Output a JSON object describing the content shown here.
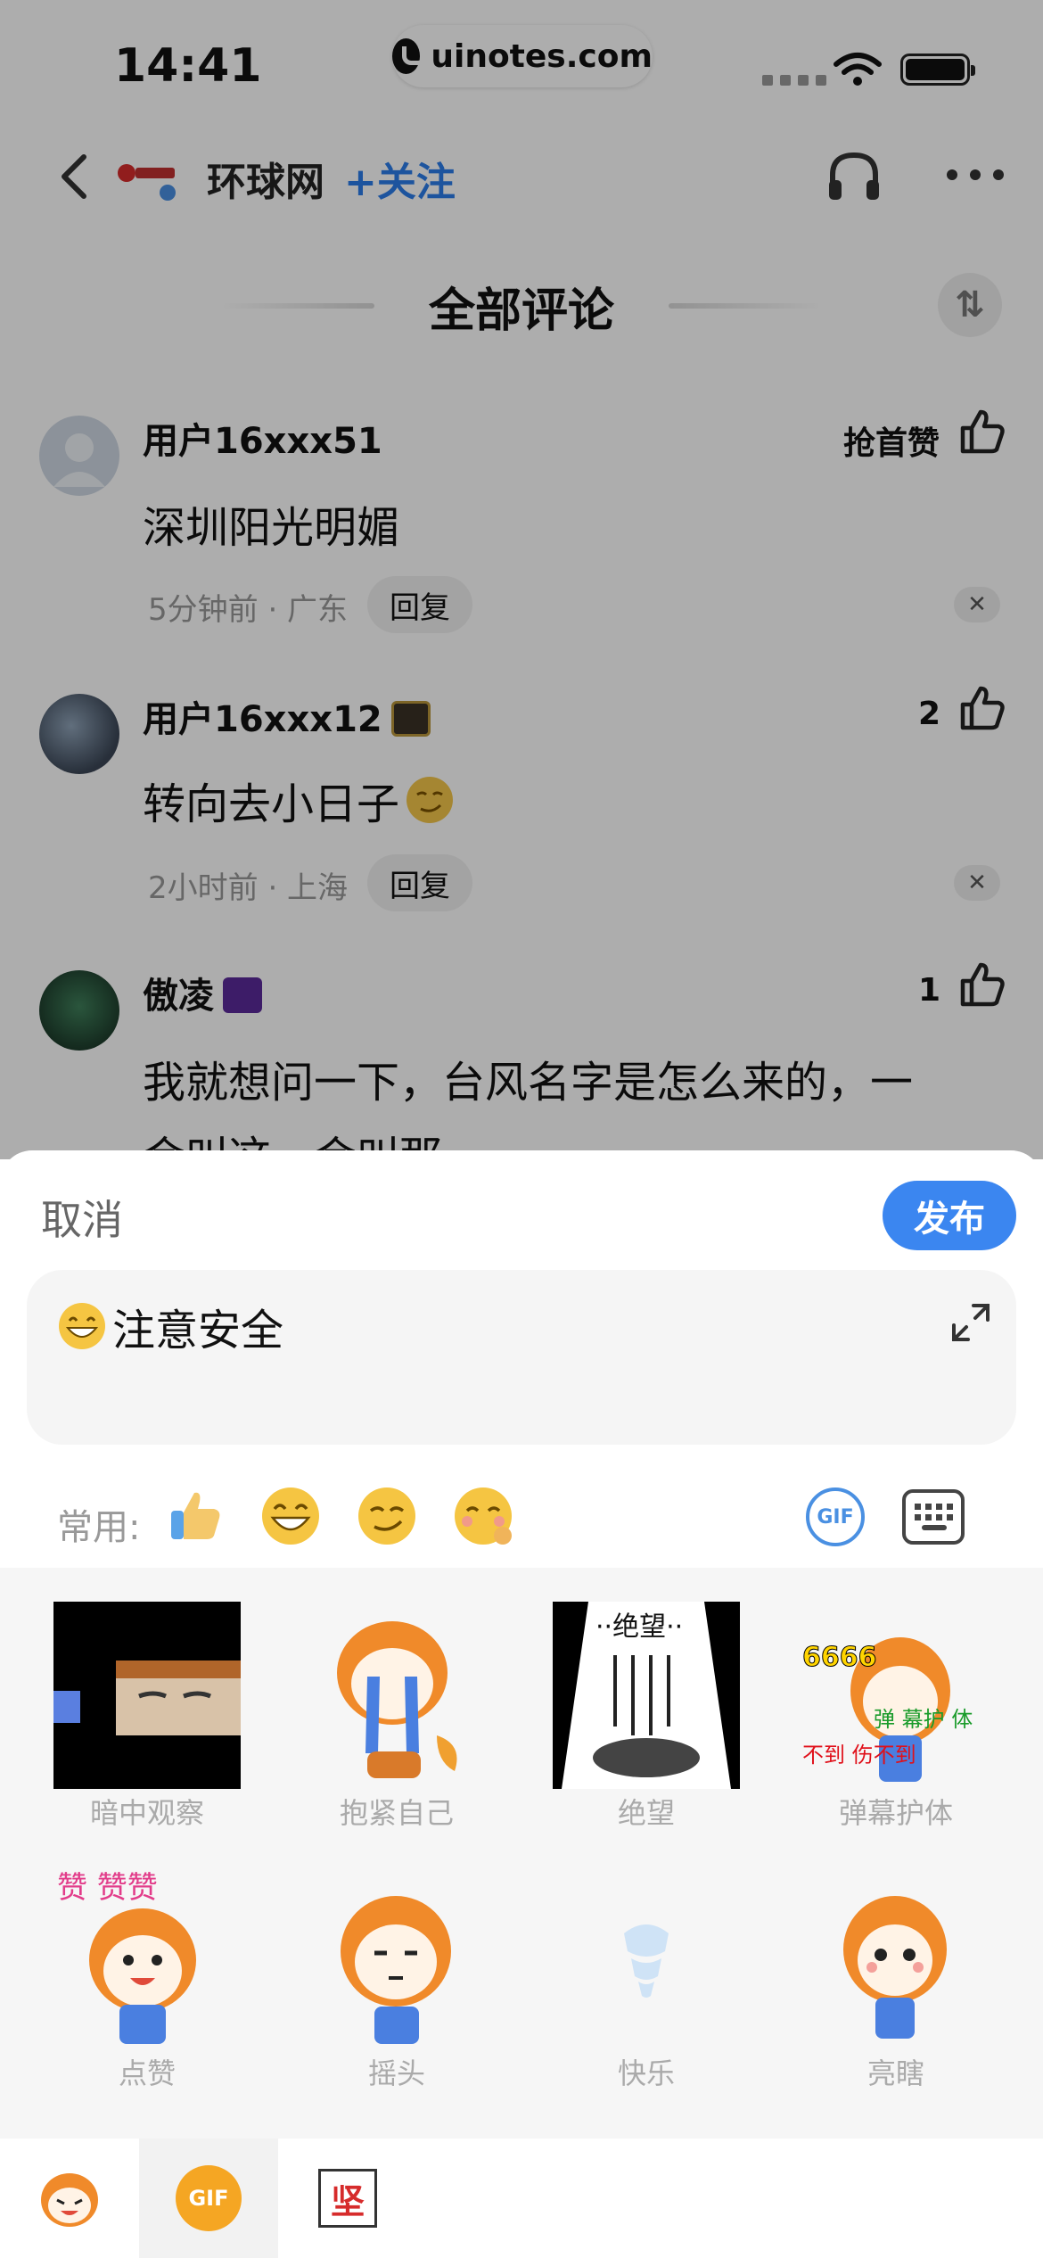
{
  "status_bar": {
    "time": "14:41",
    "url": "uinotes.com"
  },
  "header": {
    "publisher": "环球网",
    "follow": "+关注"
  },
  "section": {
    "title": "全部评论"
  },
  "comments": [
    {
      "user": "用户16xxx51",
      "text": "深圳阳光明媚",
      "meta": "5分钟前 · 广东",
      "reply": "回复",
      "likes": "抢首赞"
    },
    {
      "user": "用户16xxx12",
      "text": "转向去小日子",
      "meta": "2小时前 · 上海",
      "reply": "回复",
      "likes": "2"
    },
    {
      "user": "傲凌",
      "text": "我就想问一下，台风名字是怎么来的，一",
      "text2": "会叫这一会叫那",
      "likes": "1"
    }
  ],
  "sheet": {
    "cancel": "取消",
    "publish": "发布",
    "input_value": "注意安全",
    "common_label": "常用:",
    "gif_label": "GIF"
  },
  "stickers": [
    {
      "label": "暗中观察"
    },
    {
      "label": "抱紧自己"
    },
    {
      "label": "绝望"
    },
    {
      "label": "弹幕护体"
    },
    {
      "label": "点赞"
    },
    {
      "label": "摇头"
    },
    {
      "label": "快乐"
    },
    {
      "label": "亮瞎"
    }
  ],
  "tabs": {
    "gif": "GIF",
    "stamp": "坚"
  },
  "colors": {
    "accent": "#3b86f0",
    "follow": "#2b7de9"
  }
}
